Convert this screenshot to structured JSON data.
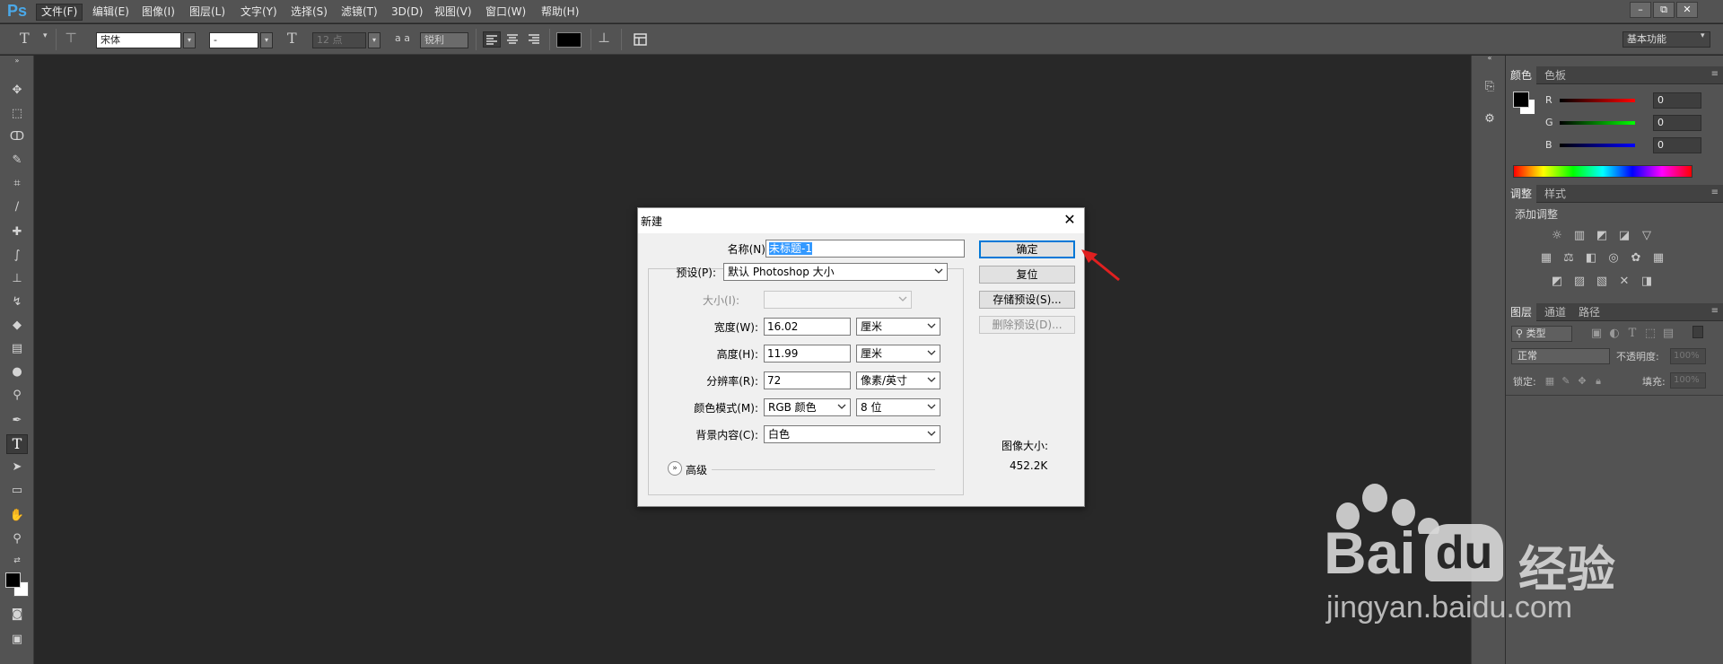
{
  "menubar": {
    "logo": "Ps",
    "items": [
      "文件(F)",
      "编辑(E)",
      "图像(I)",
      "图层(L)",
      "文字(Y)",
      "选择(S)",
      "滤镜(T)",
      "3D(D)",
      "视图(V)",
      "窗口(W)",
      "帮助(H)"
    ],
    "window_buttons": [
      "–",
      "⧉",
      "✕"
    ]
  },
  "options_bar": {
    "font_family": "宋体",
    "font_style": "-",
    "font_size": "12 点",
    "aa_label": "a a",
    "antialias": "锐利",
    "workspace": "基本功能"
  },
  "dialog": {
    "title": "新建",
    "name_label": "名称(N):",
    "name_value": "未标题-1",
    "preset_label": "预设(P):",
    "preset_value": "默认 Photoshop 大小",
    "size_label": "大小(I):",
    "width_label": "宽度(W):",
    "width_value": "16.02",
    "width_unit": "厘米",
    "height_label": "高度(H):",
    "height_value": "11.99",
    "height_unit": "厘米",
    "resolution_label": "分辨率(R):",
    "resolution_value": "72",
    "resolution_unit": "像素/英寸",
    "color_mode_label": "颜色模式(M):",
    "color_mode_value": "RGB 颜色",
    "bit_depth": "8 位",
    "background_label": "背景内容(C):",
    "background_value": "白色",
    "advanced_label": "高级",
    "ok_button": "确定",
    "reset_button": "复位",
    "save_preset_button": "存储预设(S)...",
    "delete_preset_button": "删除预设(D)...",
    "image_size_label": "图像大小:",
    "image_size_value": "452.2K"
  },
  "color_panel": {
    "tabs": [
      "颜色",
      "色板"
    ],
    "channels": [
      {
        "label": "R",
        "value": "0",
        "color": "#ff0000"
      },
      {
        "label": "G",
        "value": "0",
        "color": "#00ff00"
      },
      {
        "label": "B",
        "value": "0",
        "color": "#0000ff"
      }
    ]
  },
  "adjust_panel": {
    "tabs": [
      "调整",
      "样式"
    ],
    "add_label": "添加调整"
  },
  "layers_panel": {
    "tabs": [
      "图层",
      "通道",
      "路径"
    ],
    "filter_kind": "类型",
    "blend_mode": "正常",
    "opacity_label": "不透明度:",
    "opacity_value": "100%",
    "lock_label": "锁定:",
    "fill_label": "填充:",
    "fill_value": "100%"
  },
  "watermark": {
    "brand": "Bai",
    "brand_du": "du",
    "brand_cn": "经验",
    "url": "jingyan.baidu.com"
  }
}
